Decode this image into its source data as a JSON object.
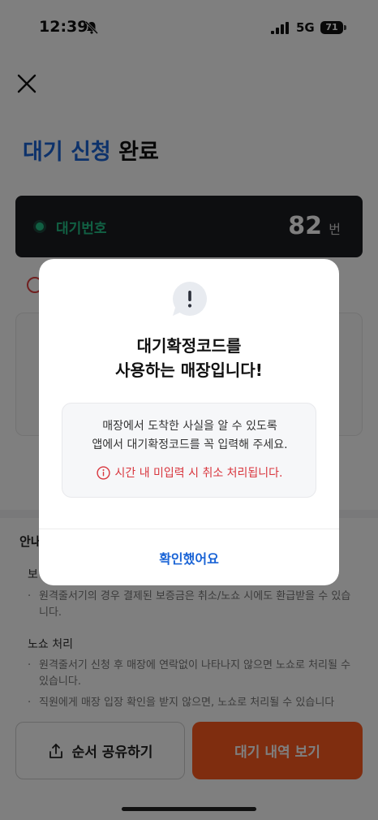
{
  "status_bar": {
    "time": "12:39",
    "network": "5G",
    "battery": "71"
  },
  "page": {
    "title_accent": "대기 신청",
    "title_rest": " 완료",
    "queue": {
      "label": "대기번호",
      "number": "82",
      "unit": "번"
    },
    "guide": {
      "title": "안내",
      "deposit_title": "보",
      "deposit_bullet": "원격줄서기의 경우 결제된 보증금은 취소/노쇼 시에도 환급받을 수 있습니다.",
      "noshow_title": "노쇼 처리",
      "noshow_bullets": [
        "원격줄서기 신청 후 매장에 연락없이 나타나지 않으면 노쇼로 처리될 수 있습니다.",
        "직원에게 매장 입장 확인을 받지 않으면, 노쇼로 처리될 수 있습니다"
      ]
    },
    "bottom": {
      "share_label": "순서 공유하기",
      "history_label": "대기 내역 보기"
    }
  },
  "modal": {
    "title_line1": "대기확정코드를",
    "title_line2": "사용하는 매장입니다!",
    "notice_line1": "매장에서 도착한 사실을 알 수 있도록",
    "notice_line2": "앱에서 대기확정코드를 꼭 입력해 주세요.",
    "warning": "시간 내 미입력 시 취소 처리됩니다.",
    "confirm_label": "확인했어요"
  },
  "colors": {
    "accent_blue": "#1a64d6",
    "queue_green": "#23c087",
    "warning_red": "#d9363e",
    "history_orange": "#ff5a1f"
  },
  "icons": [
    "bell-slash-icon",
    "signal-icon",
    "battery-icon",
    "close-icon",
    "info-icon",
    "share-icon",
    "exclamation-bubble-icon",
    "warning-info-icon"
  ]
}
